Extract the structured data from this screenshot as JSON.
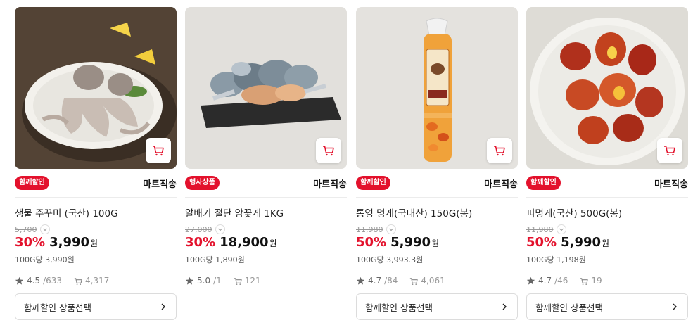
{
  "products": [
    {
      "badge": "함께할인",
      "shipping": "마트직송",
      "name": "생물 주꾸미 (국산) 100G",
      "original_price": "5,700",
      "discount_rate": "30%",
      "price": "3,990",
      "currency": "원",
      "unit_price": "100G당 3,990원",
      "rating": "4.5",
      "rating_count": "/633",
      "purchase_count": "4,317",
      "combo_label": "함께할인 상품선택"
    },
    {
      "badge": "행사상품",
      "shipping": "마트직송",
      "name": "알배기 절단 암꽃게 1KG",
      "original_price": "27,000",
      "discount_rate": "30%",
      "price": "18,900",
      "currency": "원",
      "unit_price": "100G당 1,890원",
      "rating": "5.0",
      "rating_count": "/1",
      "purchase_count": "121",
      "combo_label": ""
    },
    {
      "badge": "함께할인",
      "shipping": "마트직송",
      "name": "통영 멍게(국내산) 150G(봉)",
      "original_price": "11,980",
      "discount_rate": "50%",
      "price": "5,990",
      "currency": "원",
      "unit_price": "100G당 3,993.3원",
      "rating": "4.7",
      "rating_count": "/84",
      "purchase_count": "4,061",
      "combo_label": "함께할인 상품선택",
      "package_text": "국산멍게"
    },
    {
      "badge": "함께할인",
      "shipping": "마트직송",
      "name": "피멍게(국산) 500G(봉)",
      "original_price": "11,980",
      "discount_rate": "50%",
      "price": "5,990",
      "currency": "원",
      "unit_price": "100G당 1,198원",
      "rating": "4.7",
      "rating_count": "/46",
      "purchase_count": "19",
      "combo_label": "함께할인 상품선택"
    }
  ],
  "icons": {
    "cart": "cart-icon",
    "star": "star-icon",
    "purchase": "purchase-count-icon",
    "chevron": "chevron-right-icon"
  },
  "colors": {
    "accent": "#e3112c",
    "text": "#222222",
    "muted": "#999999"
  }
}
